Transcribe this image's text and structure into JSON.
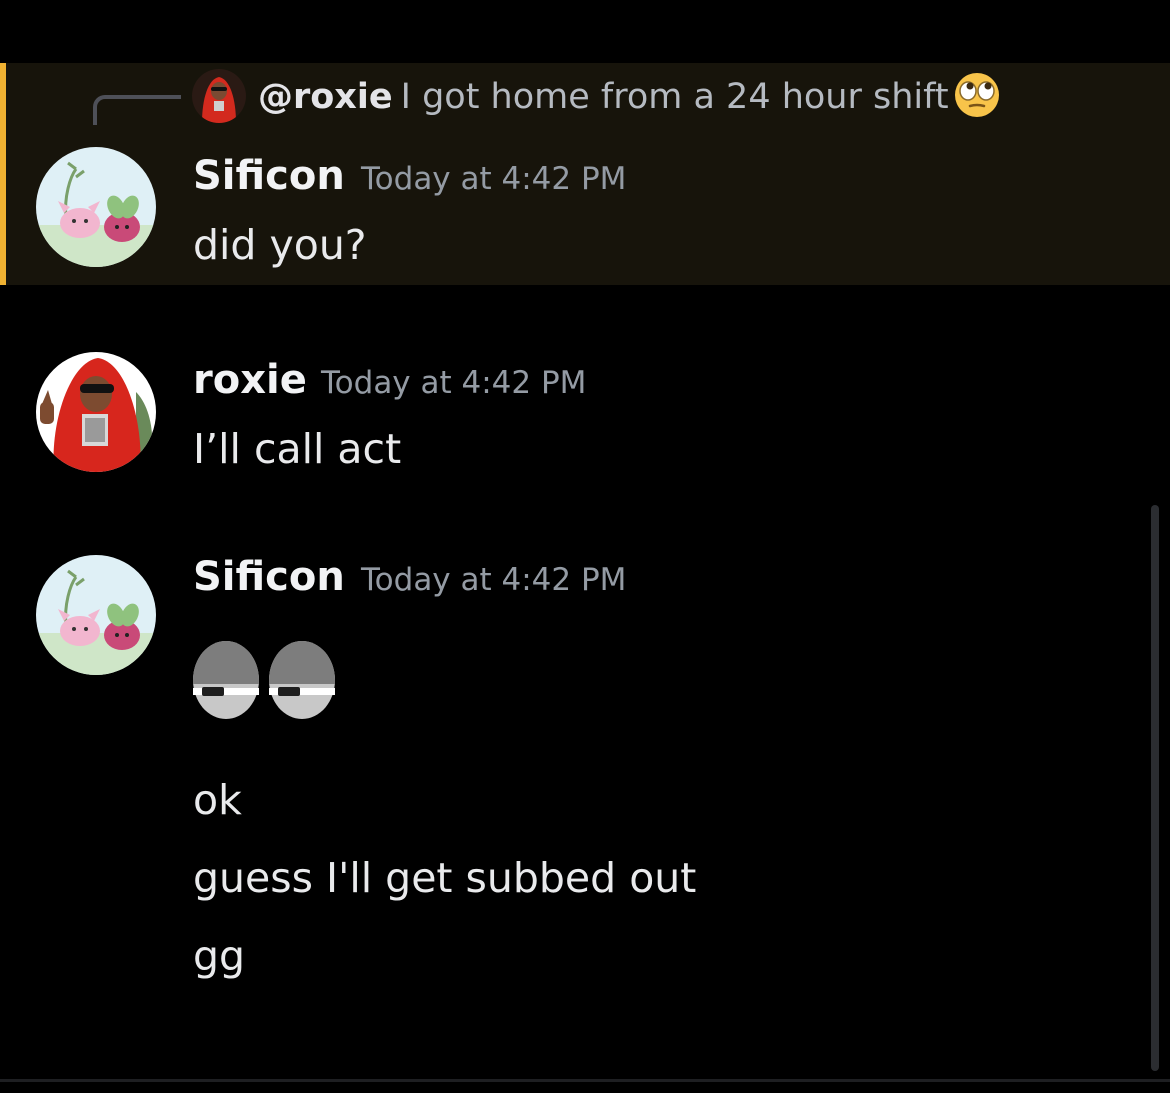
{
  "colors": {
    "background": "#000000",
    "mention_highlight": "#17140b",
    "mention_bar": "#f0b232",
    "username": "#f2f3f5",
    "timestamp": "#949ba4",
    "text": "#e9eaec"
  },
  "reply": {
    "author": "@roxie",
    "text": "I got home from a 24 hour shift",
    "emoji_icon": "face-with-rolling-eyes-icon"
  },
  "messages": [
    {
      "author": "Sificon",
      "timestamp": "Today at 4:42 PM",
      "lines": [
        "did you?"
      ],
      "avatar_icon": "pokemon-avatar-icon",
      "highlighted": true
    },
    {
      "author": "roxie",
      "timestamp": "Today at 4:42 PM",
      "lines": [
        "I’ll call act"
      ],
      "avatar_icon": "red-hoodie-avatar-icon"
    },
    {
      "author": "Sificon",
      "timestamp": "Today at 4:42 PM",
      "emoji_only": "sleepy-eyes-emoji-icon",
      "lines": [
        "ok",
        "guess I'll get subbed out",
        "gg"
      ],
      "avatar_icon": "pokemon-avatar-icon"
    }
  ]
}
